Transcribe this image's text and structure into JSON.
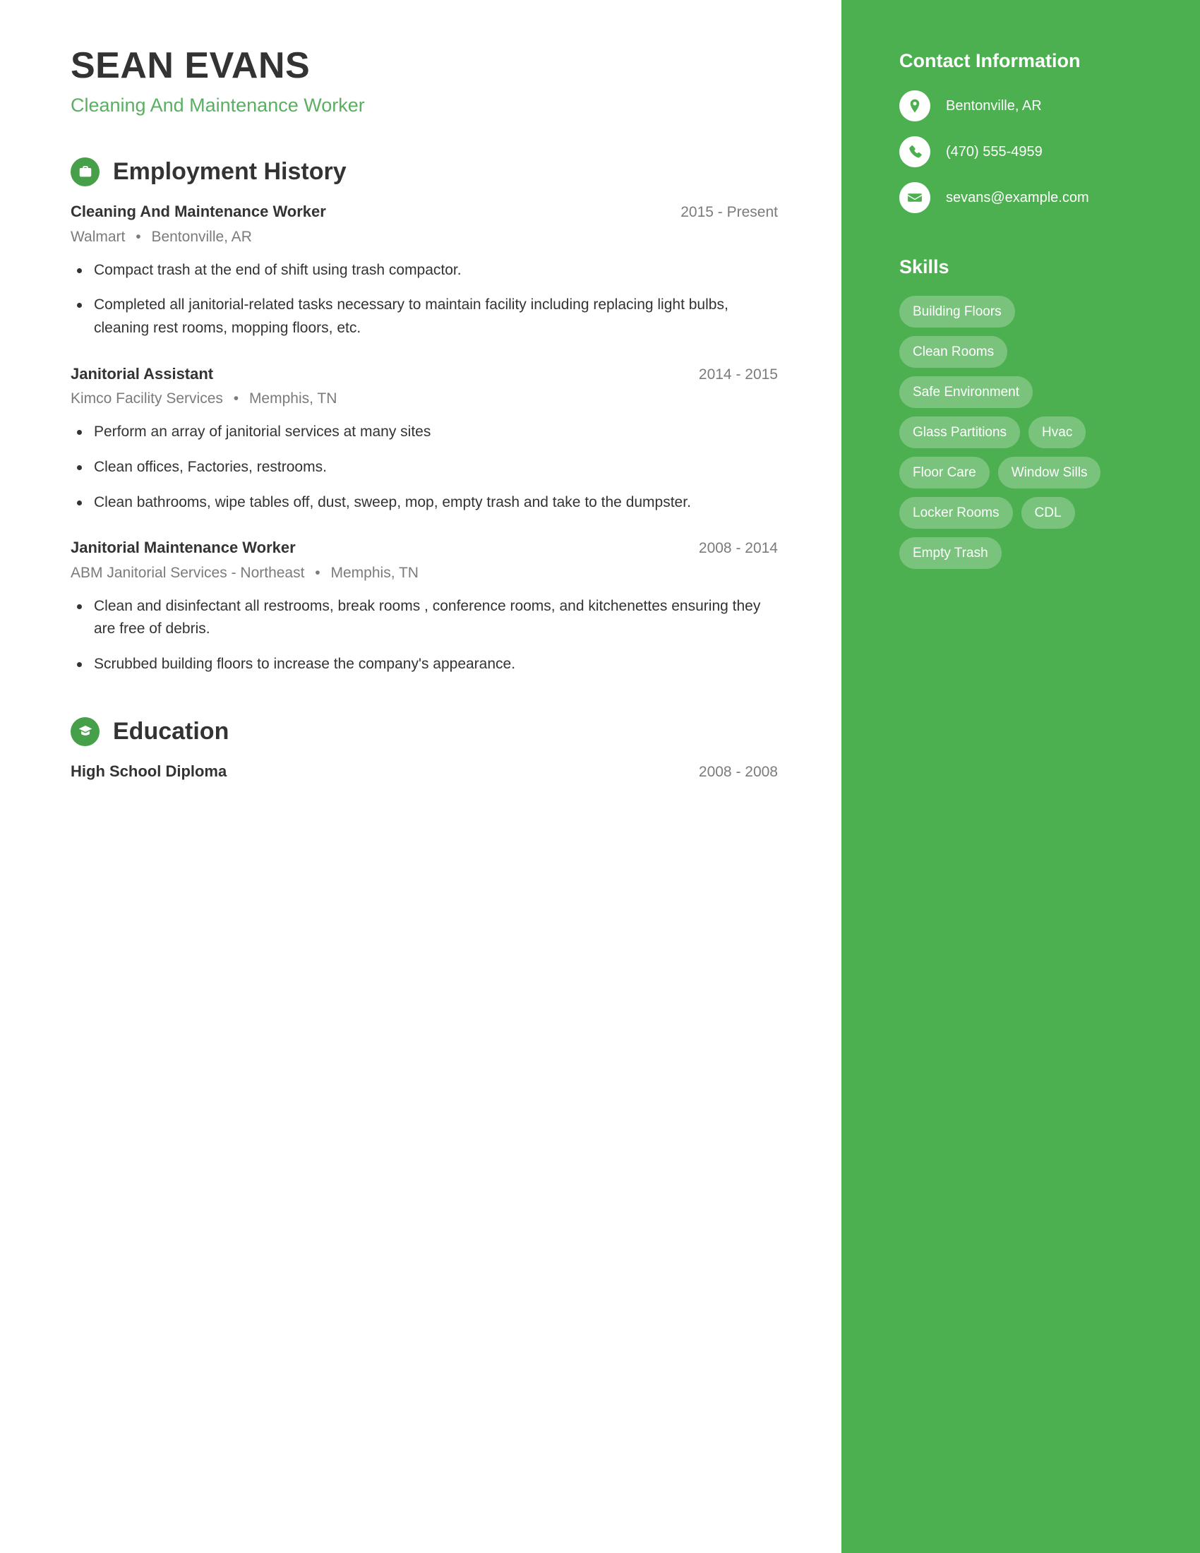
{
  "colors": {
    "sidebar_bg": "#4caf50",
    "accent_green": "#5aaf63",
    "icon_circle": "#45a049",
    "text_dark": "#333333",
    "text_muted": "#7b7b7b",
    "pill_bg": "rgba(255,255,255,0.26)"
  },
  "header": {
    "name": "SEAN EVANS",
    "subtitle": "Cleaning And Maintenance Worker"
  },
  "employment": {
    "section_title": "Employment History",
    "icon": "briefcase-icon",
    "entries": [
      {
        "title": "Cleaning And Maintenance Worker",
        "date": "2015 - Present",
        "company": "Walmart",
        "location": "Bentonville, AR",
        "bullets": [
          "Compact trash at the end of shift using trash compactor.",
          "Completed all janitorial-related tasks necessary to maintain facility including replacing light bulbs, cleaning rest rooms, mopping floors, etc."
        ]
      },
      {
        "title": "Janitorial Assistant",
        "date": "2014 - 2015",
        "company": "Kimco Facility Services",
        "location": "Memphis, TN",
        "bullets": [
          "Perform an array of janitorial services at many sites",
          "Clean offices, Factories, restrooms.",
          "Clean bathrooms, wipe tables off, dust, sweep, mop, empty trash and take to the dumpster."
        ]
      },
      {
        "title": "Janitorial Maintenance Worker",
        "date": "2008 - 2014",
        "company": "ABM Janitorial Services - Northeast",
        "location": "Memphis, TN",
        "bullets": [
          "Clean and disinfectant all restrooms, break rooms , conference rooms, and kitchenettes ensuring they are free of debris.",
          "Scrubbed building floors to increase the company's appearance."
        ]
      }
    ]
  },
  "education": {
    "section_title": "Education",
    "icon": "graduation-cap-icon",
    "entries": [
      {
        "title": "High School Diploma",
        "date": "2008 - 2008"
      }
    ]
  },
  "sidebar": {
    "contact_title": "Contact Information",
    "contact": [
      {
        "icon": "map-pin-icon",
        "value": "Bentonville, AR"
      },
      {
        "icon": "phone-icon",
        "value": "(470) 555-4959"
      },
      {
        "icon": "envelope-icon",
        "value": "sevans@example.com"
      }
    ],
    "skills_title": "Skills",
    "skills": [
      "Building Floors",
      "Clean Rooms",
      "Safe Environment",
      "Glass Partitions",
      "Hvac",
      "Floor Care",
      "Window Sills",
      "Locker Rooms",
      "CDL",
      "Empty Trash"
    ]
  }
}
